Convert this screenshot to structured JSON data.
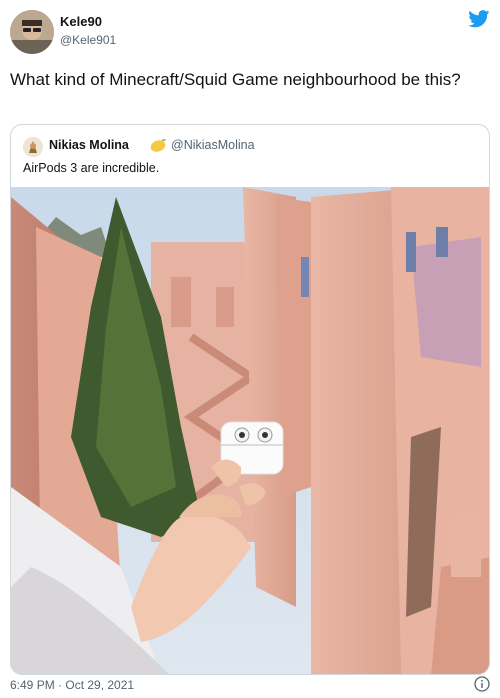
{
  "author": {
    "name": "Kele90",
    "handle": "@Kele901"
  },
  "tweet": {
    "text": "What kind of Minecraft/Squid Game neighbourhood be this?"
  },
  "quoted": {
    "name": "Nikias Molina",
    "handle": "@NikiasMolina",
    "text": "AirPods 3 are incredible.",
    "emoji": "lemon-emoji"
  },
  "footer": {
    "timestamp": "6:49 PM · Oct 29, 2021"
  },
  "icons": {
    "brand": "twitter-bird-icon",
    "info": "info-icon"
  },
  "colors": {
    "twitter_blue": "#1d9bf0",
    "secondary_text": "#536471",
    "border": "#cfd9de"
  }
}
